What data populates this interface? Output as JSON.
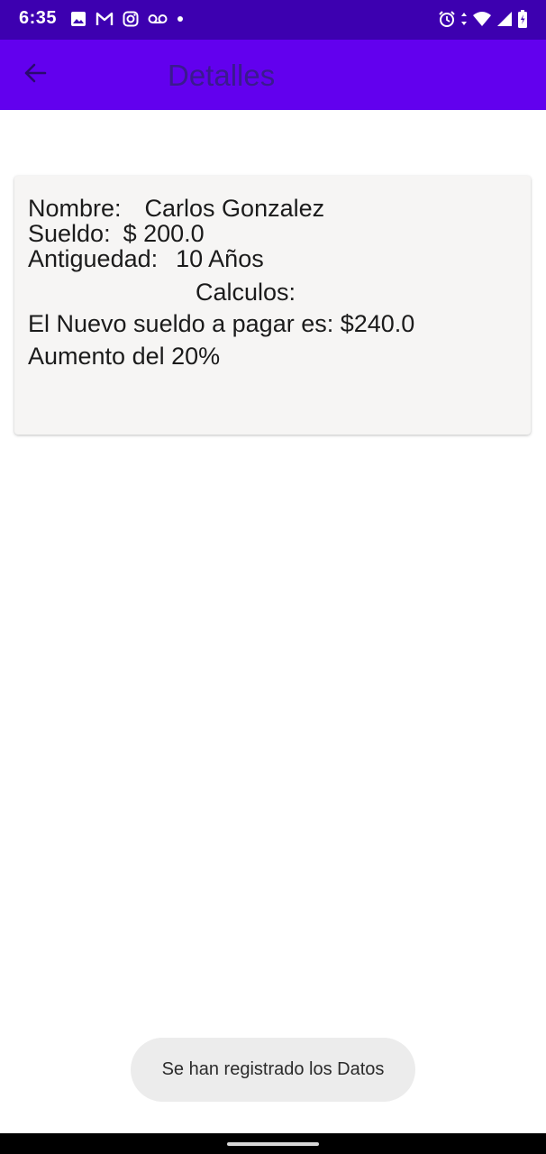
{
  "status_bar": {
    "time": "6:35",
    "left_icons": [
      "image-icon",
      "gmail-icon",
      "instagram-icon",
      "voicemail-icon",
      "dot-icon"
    ],
    "right_icons": [
      "alarm-icon",
      "data-arrows-icon",
      "wifi-icon",
      "signal-icon",
      "battery-icon"
    ],
    "background_color": "#3d00b0"
  },
  "app_bar": {
    "title": "Detalles",
    "back_icon": "arrow-left-icon",
    "background_color": "#6200ee"
  },
  "details": {
    "nombre_label": "Nombre:",
    "nombre_value": "Carlos Gonzalez",
    "sueldo_label": "Sueldo:",
    "sueldo_value": "$ 200.0",
    "antiguedad_label": "Antiguedad:",
    "antiguedad_value": "10 Años",
    "calculos_label": "Calculos:",
    "nuevo_sueldo_text": "El Nuevo sueldo a pagar es: $240.0",
    "aumento_text": "Aumento del 20%"
  },
  "toast": {
    "message": "Se han registrado los Datos"
  }
}
